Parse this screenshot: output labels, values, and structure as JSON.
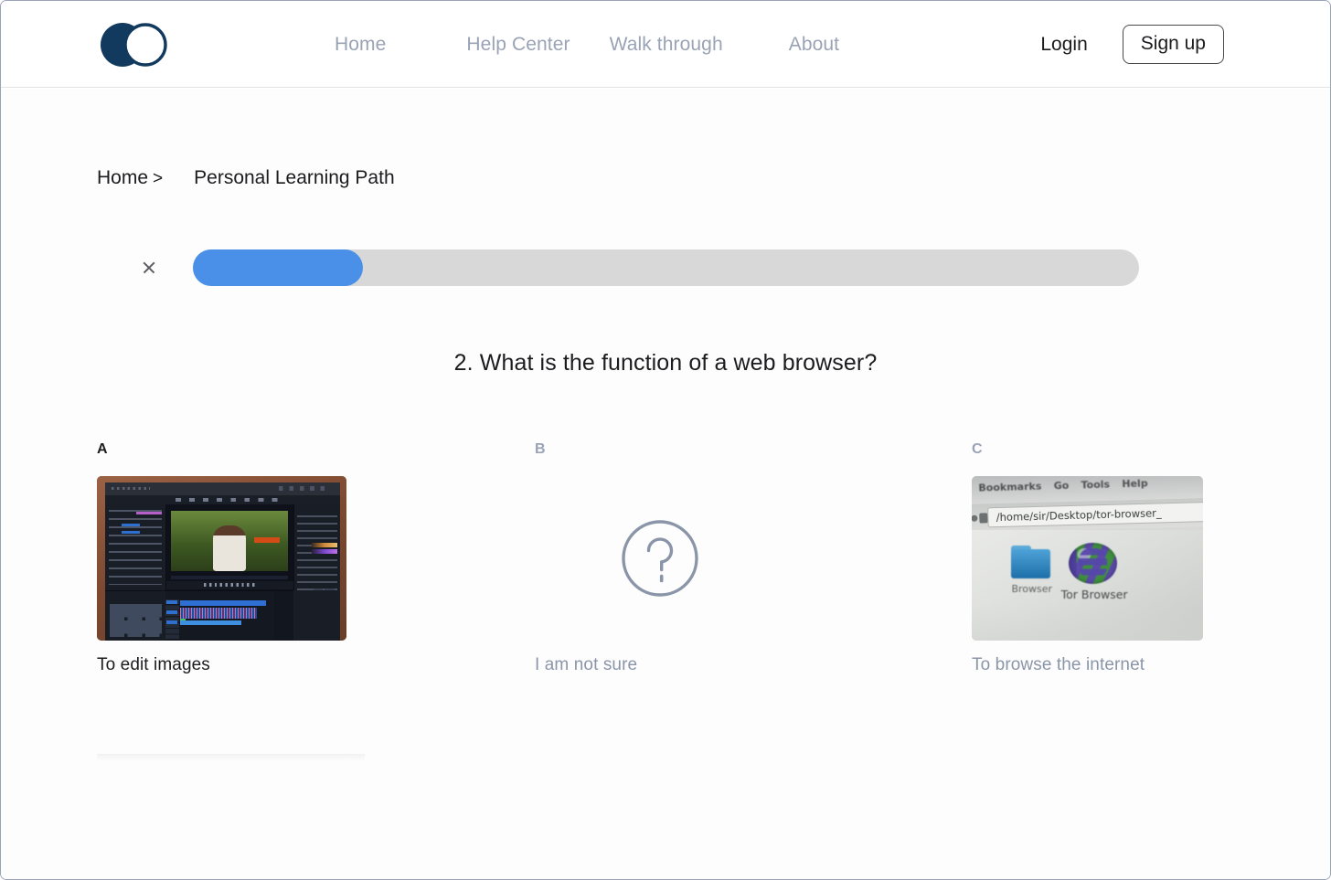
{
  "header": {
    "logo_name": "brand-logo",
    "nav": [
      {
        "label": "Home"
      },
      {
        "label": "Help Center"
      },
      {
        "label": "Walk through"
      },
      {
        "label": "About"
      }
    ],
    "login_label": "Login",
    "signup_label": "Sign up"
  },
  "breadcrumb": {
    "home": "Home",
    "separator": ">",
    "current": "Personal Learning Path"
  },
  "progress": {
    "close_label": "×",
    "percent": 18,
    "fill_color": "#4a90e8",
    "track_color": "#d8d8d8"
  },
  "question": {
    "text": "2. What is the function of a web browser?"
  },
  "options": [
    {
      "letter": "A",
      "text": "To edit images",
      "state": "active",
      "media": "video-editing-software-screenshot"
    },
    {
      "letter": "B",
      "text": "I am not sure",
      "state": "inactive",
      "media": "question-mark-icon"
    },
    {
      "letter": "C",
      "text": "To browse the internet",
      "state": "inactive",
      "media": "tor-browser-desktop-photo"
    }
  ],
  "option_c_image": {
    "menu_items": [
      "Bookmarks",
      "Go",
      "Tools",
      "Help"
    ],
    "address": "/home/sir/Desktop/tor-browser_",
    "folder_label": "Browser",
    "app_label": "Tor Browser"
  },
  "colors": {
    "brand_navy": "#123a5e",
    "muted": "#9aa3b5",
    "text": "#1c1c1e"
  }
}
